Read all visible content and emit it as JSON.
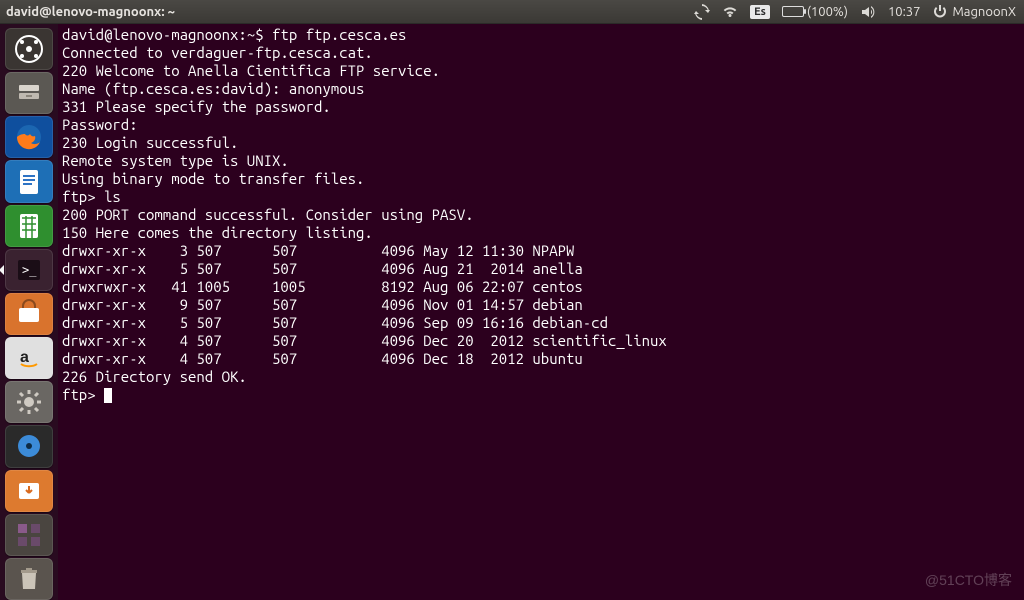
{
  "panel": {
    "title": "david@lenovo-magnoonx: ~",
    "lang": "Es",
    "battery_pct": "(100%)",
    "clock": "10:37",
    "session_label": "MagnoonX"
  },
  "launcher": {
    "items": [
      {
        "name": "dash",
        "bg": "#3a3532",
        "active": false
      },
      {
        "name": "files",
        "bg": "#5b5853",
        "active": false
      },
      {
        "name": "firefox",
        "bg": "#0f4f9e",
        "active": false
      },
      {
        "name": "libreoffice-writer",
        "bg": "#1e6fb6",
        "active": false
      },
      {
        "name": "libreoffice-calc",
        "bg": "#2f8f2f",
        "active": false
      },
      {
        "name": "terminal",
        "bg": "#3a2230",
        "active": true
      },
      {
        "name": "software-center",
        "bg": "#d9732d",
        "active": false
      },
      {
        "name": "amazon",
        "bg": "#e0e0e0",
        "active": false
      },
      {
        "name": "settings",
        "bg": "#6a6763",
        "active": false
      },
      {
        "name": "disk-utility",
        "bg": "#2a2a2a",
        "active": false
      },
      {
        "name": "update-manager",
        "bg": "#dd7a2f",
        "active": false
      },
      {
        "name": "workspace-switcher",
        "bg": "#4a4540",
        "active": false
      },
      {
        "name": "trash",
        "bg": "#5a544e",
        "active": false
      }
    ]
  },
  "terminal": {
    "prompt_user": "david@lenovo-magnoonx",
    "prompt_path": "~",
    "cmd1": "ftp ftp.cesca.es",
    "lines_intro": [
      "Connected to verdaguer-ftp.cesca.cat.",
      "220 Welcome to Anella Cientifica FTP service.",
      "Name (ftp.cesca.es:david): anonymous",
      "331 Please specify the password.",
      "Password:",
      "230 Login successful.",
      "Remote system type is UNIX.",
      "Using binary mode to transfer files."
    ],
    "ftp_prompt": "ftp>",
    "cmd2": "ls",
    "lines_ls_head": [
      "200 PORT command successful. Consider using PASV.",
      "150 Here comes the directory listing."
    ],
    "listing": [
      {
        "perm": "drwxr-xr-x",
        "n": "  3",
        "u": "507 ",
        "g": "507 ",
        "sz": "4096",
        "date": "May 12 11:30",
        "name": "NPAPW"
      },
      {
        "perm": "drwxr-xr-x",
        "n": "  5",
        "u": "507 ",
        "g": "507 ",
        "sz": "4096",
        "date": "Aug 21  2014",
        "name": "anella"
      },
      {
        "perm": "drwxrwxr-x",
        "n": " 41",
        "u": "1005",
        "g": "1005",
        "sz": "8192",
        "date": "Aug 06 22:07",
        "name": "centos"
      },
      {
        "perm": "drwxr-xr-x",
        "n": "  9",
        "u": "507 ",
        "g": "507 ",
        "sz": "4096",
        "date": "Nov 01 14:57",
        "name": "debian"
      },
      {
        "perm": "drwxr-xr-x",
        "n": "  5",
        "u": "507 ",
        "g": "507 ",
        "sz": "4096",
        "date": "Sep 09 16:16",
        "name": "debian-cd"
      },
      {
        "perm": "drwxr-xr-x",
        "n": "  4",
        "u": "507 ",
        "g": "507 ",
        "sz": "4096",
        "date": "Dec 20  2012",
        "name": "scientific_linux"
      },
      {
        "perm": "drwxr-xr-x",
        "n": "  4",
        "u": "507 ",
        "g": "507 ",
        "sz": "4096",
        "date": "Dec 18  2012",
        "name": "ubuntu"
      }
    ],
    "lines_ls_tail": [
      "226 Directory send OK."
    ]
  },
  "watermark": "@51CTO博客"
}
